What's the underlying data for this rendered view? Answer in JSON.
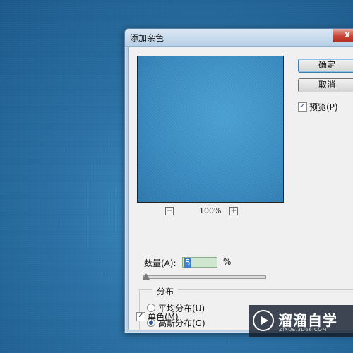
{
  "dialog": {
    "title": "添加杂色",
    "close_label": "x"
  },
  "preview": {
    "zoom_out": "−",
    "zoom_in": "+",
    "zoom_level": "100%"
  },
  "buttons": {
    "ok": "确定",
    "cancel": "取消"
  },
  "preview_option": {
    "label": "预览(P)",
    "checked": true,
    "check_mark": "✓"
  },
  "amount": {
    "label": "数量(A):",
    "value": "5",
    "unit": "%",
    "slider_percent": 5
  },
  "distribution": {
    "title": "分布",
    "options": [
      {
        "label": "平均分布(U)",
        "selected": false
      },
      {
        "label": "高斯分布(G)",
        "selected": true
      }
    ]
  },
  "monochrome": {
    "label": "单色(M)",
    "checked": true,
    "check_mark": "✓"
  },
  "watermark": {
    "name": "溜溜自学",
    "url": "ZIXUE.3D66.COM"
  },
  "colors": {
    "background": "#2a73a8",
    "preview": "#3a8cc4",
    "dialog_frame": "#bcd1e6",
    "close_button": "#c8473a"
  }
}
